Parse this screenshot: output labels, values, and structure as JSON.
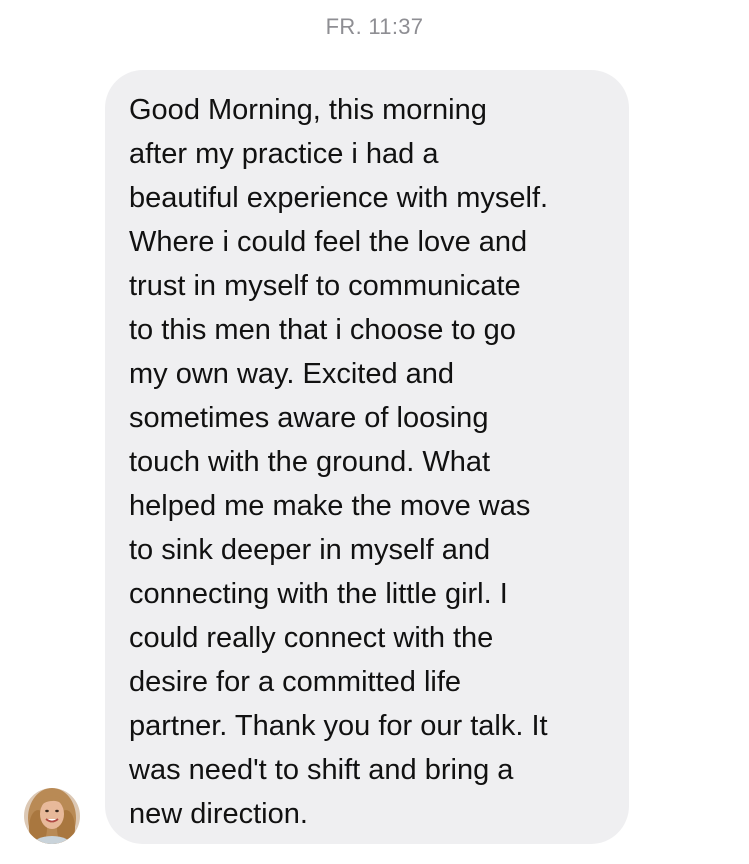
{
  "conversation": {
    "timestamp": "FR. 11:37",
    "message": {
      "sender_avatar_icon": "profile-photo",
      "bubble_color": "#efeff1",
      "lines": [
        "Good Morning, this morning",
        "after my practice i had a",
        "beautiful experience with myself.",
        "Where i could feel the love and",
        "trust in myself to communicate",
        "to this men that i choose to go",
        "my own way. Excited and",
        "sometimes aware of loosing",
        "touch with the ground. What",
        "helped me make the move was",
        "to sink deeper in myself and",
        "connecting with the little girl. I",
        "could really connect with the",
        "desire for a committed life",
        "partner. Thank you for our talk. It",
        "was need't to shift and bring a",
        "new direction."
      ]
    }
  }
}
